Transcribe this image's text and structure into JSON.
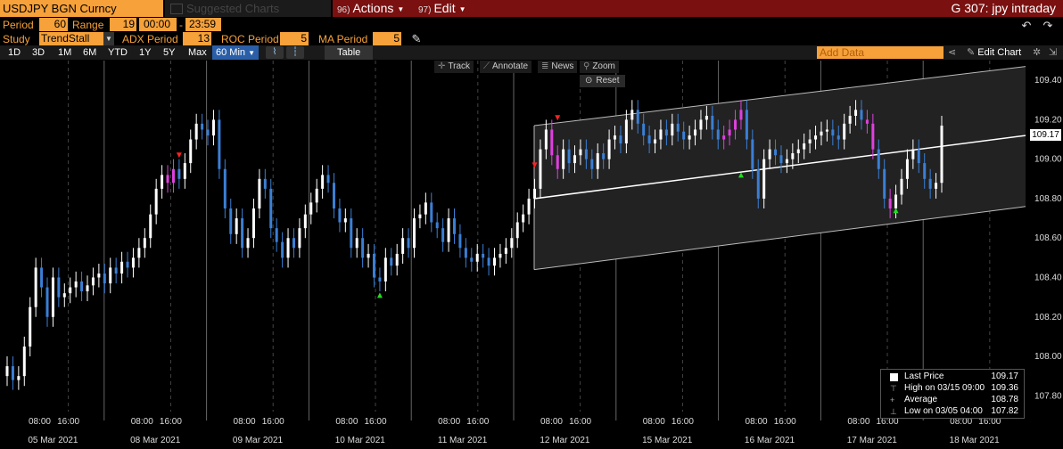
{
  "header": {
    "ticker": "USDJPY BGN Curncy",
    "suggested": "Suggested Charts",
    "actions": {
      "num": "96)",
      "label": "Actions"
    },
    "edit": {
      "num": "97)",
      "label": "Edit"
    },
    "screen_title": "G 307: jpy intraday"
  },
  "params": {
    "period_label": "Period",
    "period_value": "60",
    "range_label": "Range",
    "range_value": "19",
    "time_from": "00:00",
    "time_sep": "-",
    "time_to": "23:59",
    "study_label": "Study",
    "study_value": "TrendStall",
    "adx_label": "ADX Period",
    "adx_value": "13",
    "roc_label": "ROC Period",
    "roc_value": "5",
    "ma_label": "MA Period",
    "ma_value": "5"
  },
  "timeframes": [
    "1D",
    "3D",
    "1M",
    "6M",
    "YTD",
    "1Y",
    "5Y",
    "Max"
  ],
  "active_timeframe": "60 Min",
  "table_label": "Table",
  "add_data_placeholder": "Add Data",
  "edit_chart_label": "Edit Chart",
  "chart_tools": {
    "track": "Track",
    "annotate": "Annotate",
    "news": "News",
    "zoom": "Zoom",
    "reset": "Reset"
  },
  "legend": {
    "last_price_label": "Last Price",
    "last_price": "109.17",
    "high_label": "High on 03/15 09:00",
    "high": "109.36",
    "avg_label": "Average",
    "avg": "108.78",
    "low_label": "Low on 03/05 04:00",
    "low": "107.82"
  },
  "price_tag": "109.17",
  "colors": {
    "accent": "#f6a13a",
    "up": "#ffffff",
    "down": "#3a7fd5",
    "stall": "#e040e0",
    "menu_bar": "#7a1010"
  },
  "chart_data": {
    "type": "candlestick",
    "y_ticks": [
      "109.40",
      "109.20",
      "109.00",
      "108.80",
      "108.60",
      "108.40",
      "108.20",
      "108.00",
      "107.80"
    ],
    "ylim": [
      107.72,
      109.5
    ],
    "x_day_labels": [
      "05 Mar 2021",
      "08 Mar 2021",
      "09 Mar 2021",
      "10 Mar 2021",
      "11 Mar 2021",
      "12 Mar 2021",
      "15 Mar 2021",
      "16 Mar 2021",
      "17 Mar 2021",
      "18 Mar 2021"
    ],
    "x_time_labels": [
      "08:00",
      "16:00"
    ],
    "channel": {
      "upper": [
        109.17,
        109.47
      ],
      "middle": [
        108.8,
        109.12
      ],
      "lower": [
        108.44,
        108.76
      ]
    },
    "closes": [
      107.95,
      107.88,
      107.9,
      108.05,
      108.25,
      108.45,
      108.35,
      108.2,
      108.4,
      108.3,
      108.32,
      108.35,
      108.38,
      108.33,
      108.36,
      108.4,
      108.42,
      108.37,
      108.45,
      108.42,
      108.48,
      108.45,
      108.5,
      108.55,
      108.6,
      108.72,
      108.85,
      108.92,
      108.88,
      108.95,
      108.9,
      108.98,
      109.1,
      109.18,
      109.15,
      109.12,
      109.2,
      108.95,
      108.75,
      108.62,
      108.7,
      108.55,
      108.6,
      108.75,
      108.9,
      108.85,
      108.65,
      108.58,
      108.5,
      108.6,
      108.55,
      108.65,
      108.72,
      108.78,
      108.85,
      108.92,
      108.88,
      108.75,
      108.68,
      108.7,
      108.55,
      108.6,
      108.5,
      108.52,
      108.4,
      108.38,
      108.5,
      108.46,
      108.52,
      108.6,
      108.55,
      108.7,
      108.72,
      108.78,
      108.68,
      108.65,
      108.58,
      108.7,
      108.62,
      108.55,
      108.5,
      108.48,
      108.52,
      108.5,
      108.46,
      108.5,
      108.52,
      108.55,
      108.6,
      108.68,
      108.72,
      108.8,
      108.85,
      109.05,
      109.15,
      109.02,
      108.95,
      109.05,
      108.98,
      109.02,
      109.05,
      109.0,
      108.95,
      109.03,
      109.0,
      109.1,
      109.12,
      109.08,
      109.2,
      109.25,
      109.18,
      109.12,
      109.08,
      109.1,
      109.15,
      109.12,
      109.18,
      109.14,
      109.1,
      109.12,
      109.15,
      109.2,
      109.22,
      109.15,
      109.1,
      109.12,
      109.15,
      109.2,
      109.25,
      109.1,
      108.95,
      108.8,
      109.0,
      109.05,
      109.02,
      108.98,
      109.0,
      109.03,
      109.05,
      109.08,
      109.1,
      109.12,
      109.14,
      109.15,
      109.12,
      109.1,
      109.18,
      109.22,
      109.25,
      109.2,
      109.18,
      109.05,
      108.95,
      108.8,
      108.75,
      108.82,
      108.9,
      109.0,
      109.05,
      108.98,
      108.9,
      108.85,
      108.88,
      109.17
    ],
    "stall_bars": [
      28,
      29,
      95,
      96,
      125,
      126,
      127,
      128,
      150,
      151,
      154
    ]
  }
}
